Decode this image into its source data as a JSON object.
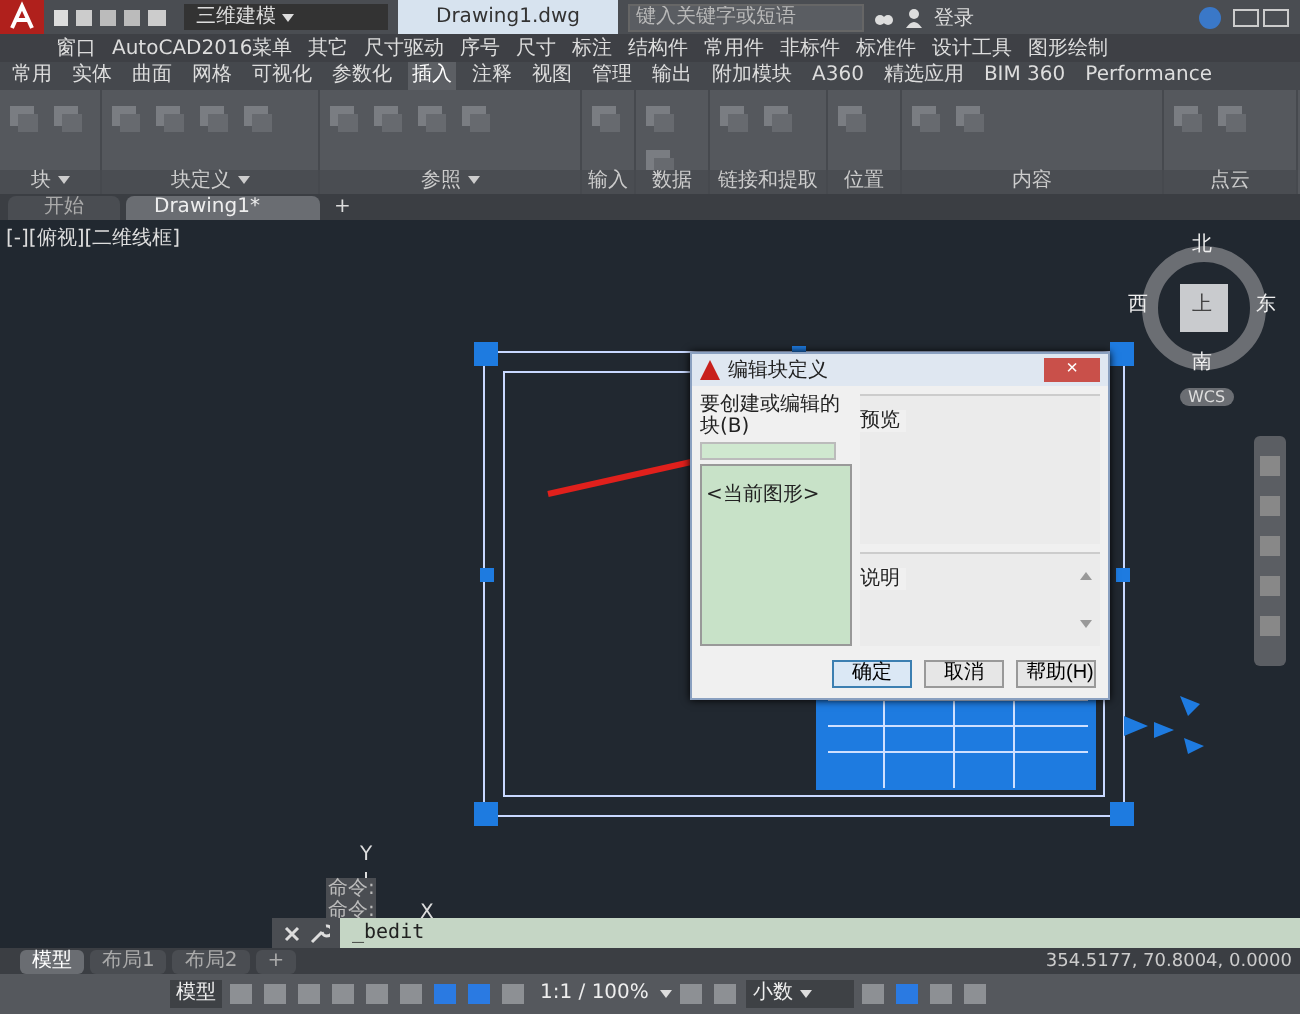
{
  "title_bar": {
    "workspace": "三维建模",
    "title": "Drawing1.dwg",
    "search": {
      "placeholder": "键入关键字或短语"
    },
    "user": "登录"
  },
  "menu_bar": [
    "窗口",
    "AutoCAD2016菜单",
    "其它",
    "尺寸驱动",
    "序号",
    "尺寸",
    "标注",
    "结构件",
    "常用件",
    "非标件",
    "标准件",
    "设计工具",
    "图形绘制"
  ],
  "ribbon_tabs": [
    {
      "label": "常用",
      "selected": false
    },
    {
      "label": "实体",
      "selected": false
    },
    {
      "label": "曲面",
      "selected": false
    },
    {
      "label": "网格",
      "selected": false
    },
    {
      "label": "可视化",
      "selected": false
    },
    {
      "label": "参数化",
      "selected": false
    },
    {
      "label": "插入",
      "selected": true
    },
    {
      "label": "注释",
      "selected": false
    },
    {
      "label": "视图",
      "selected": false
    },
    {
      "label": "管理",
      "selected": false
    },
    {
      "label": "输出",
      "selected": false
    },
    {
      "label": "附加模块",
      "selected": false
    },
    {
      "label": "A360",
      "selected": false
    },
    {
      "label": "精选应用",
      "selected": false
    },
    {
      "label": "BIM 360",
      "selected": false
    },
    {
      "label": "Performance",
      "selected": false
    }
  ],
  "ribbon_panels": [
    {
      "label": "块",
      "menu": true
    },
    {
      "label": "块定义",
      "menu": true
    },
    {
      "label": "参照",
      "menu": true
    },
    {
      "label": "输入",
      "menu": false
    },
    {
      "label": "数据",
      "menu": false
    },
    {
      "label": "链接和提取",
      "menu": false
    },
    {
      "label": "位置",
      "menu": false
    },
    {
      "label": "内容",
      "menu": false
    },
    {
      "label": "点云",
      "menu": false
    }
  ],
  "file_tabs": [
    {
      "label": "开始",
      "selected": false
    },
    {
      "label": "Drawing1*",
      "selected": true
    }
  ],
  "file_tab_add": "+",
  "viewport_label": "[-][俯视][二维线框]",
  "viewcube": {
    "north": "北",
    "west": "西",
    "top": "上",
    "east": "东",
    "south": "南",
    "ucs": "WCS"
  },
  "axis": {
    "y": "Y",
    "x": "X"
  },
  "dialog": {
    "title": "编辑块定义",
    "close": "×",
    "block_label": "要创建或编辑的块(B)",
    "block_list": [
      "<当前图形>"
    ],
    "preview_label": "预览",
    "description_label": "说明",
    "buttons": [
      "确定",
      "取消",
      "帮助(H)"
    ]
  },
  "command_line": {
    "history": [
      "命令:",
      "命令:"
    ],
    "input": "_bedit"
  },
  "coordinates": "354.5177, 70.8004, 0.0000",
  "layout_tabs": [
    {
      "label": "模型",
      "selected": true
    },
    {
      "label": "布局1",
      "selected": false
    },
    {
      "label": "布局2",
      "selected": false
    }
  ],
  "layout_tab_add": "+",
  "status_bar": {
    "model": "模型",
    "scale": "1:1 / 100%",
    "units": "小数",
    "toggles": [
      {
        "on": false
      },
      {
        "on": false
      },
      {
        "on": false
      },
      {
        "on": false
      },
      {
        "on": false
      },
      {
        "on": false
      },
      {
        "on": true
      },
      {
        "on": true
      },
      {
        "on": false
      },
      {
        "on": false
      },
      {
        "on": false
      },
      {
        "on": false
      },
      {
        "on": true
      },
      {
        "on": false
      },
      {
        "on": false
      }
    ]
  }
}
